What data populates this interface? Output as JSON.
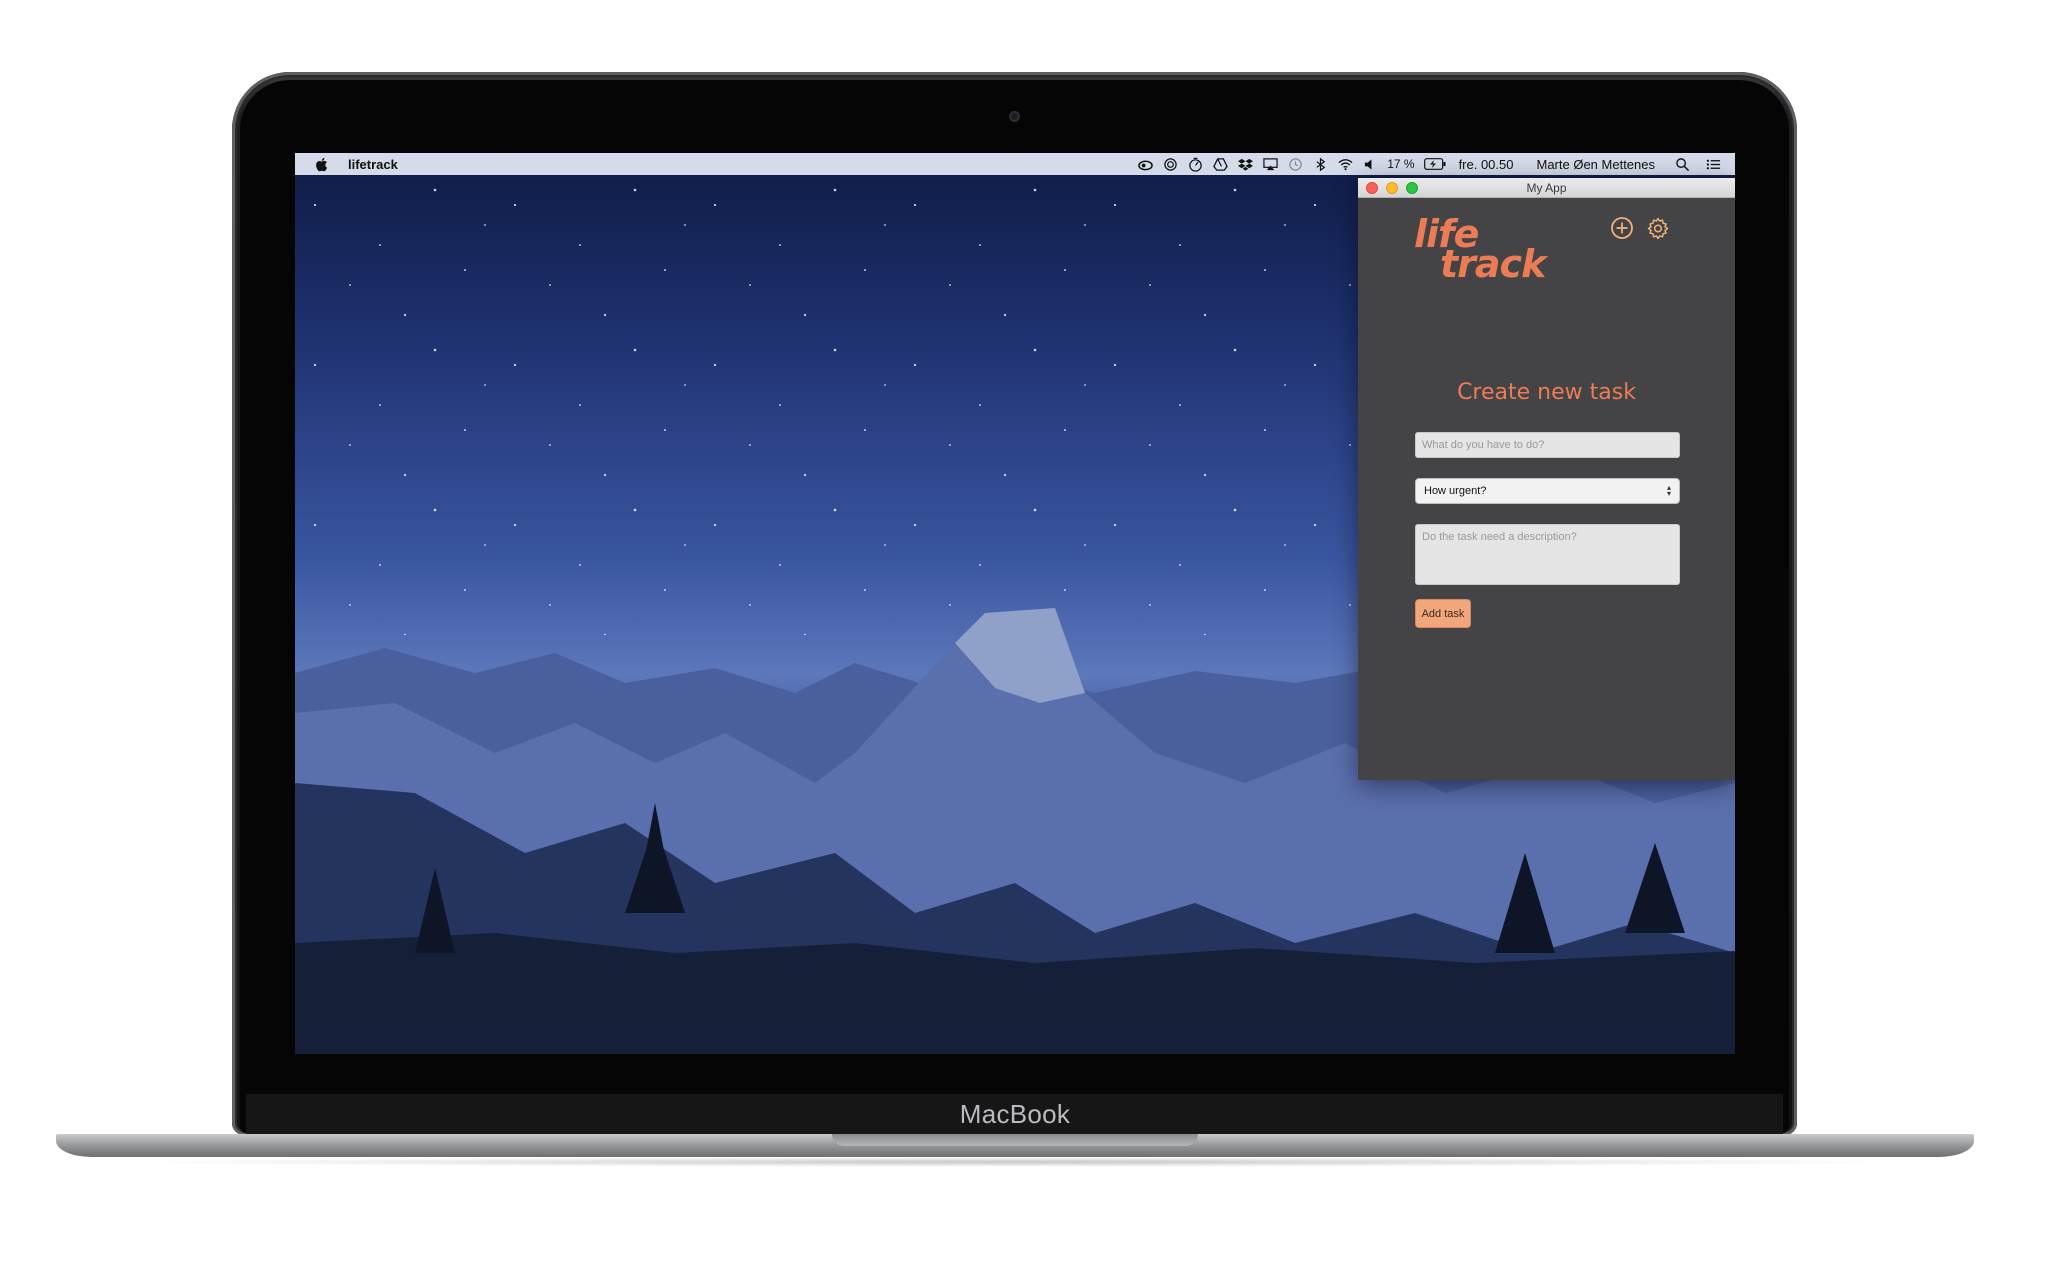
{
  "device": {
    "brand_label": "MacBook"
  },
  "menubar": {
    "app_name": "lifetrack",
    "battery_percent": "17 %",
    "clock": "fre. 00.50",
    "user_name": "Marte Øen Mettenes",
    "tray_icons": [
      "creative-cloud-icon",
      "target-icon",
      "timer-icon",
      "google-drive-icon",
      "dropbox-icon",
      "airplay-icon",
      "time-machine-icon",
      "bluetooth-icon",
      "wifi-icon",
      "volume-icon",
      "battery-icon",
      "spotlight-search-icon",
      "notification-center-icon"
    ]
  },
  "window": {
    "title": "My App",
    "logo": {
      "line1": "life",
      "line2": "track"
    },
    "form": {
      "heading": "Create new task",
      "task_placeholder": "What do you have to do?",
      "urgency_selected": "How urgent?",
      "description_placeholder": "Do the task need a description?",
      "submit_label": "Add task"
    }
  },
  "colors": {
    "accent": "#ec7c55",
    "button_bg": "#f2a67c",
    "window_bg": "#444446"
  }
}
